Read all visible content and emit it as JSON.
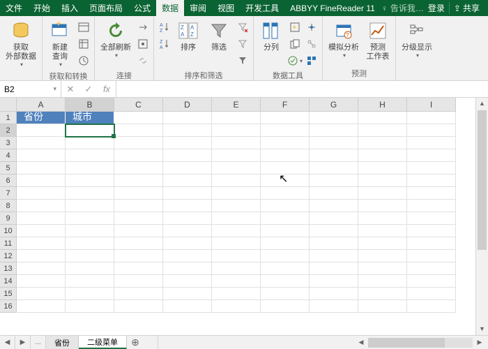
{
  "tabs": {
    "file": "文件",
    "home": "开始",
    "insert": "插入",
    "layout": "页面布局",
    "formulas": "公式",
    "data": "数据",
    "review": "审阅",
    "view": "视图",
    "dev": "开发工具",
    "abbyy": "ABBYY FineReader 11"
  },
  "titleright": {
    "tell": "告诉我…",
    "login": "登录",
    "share": "共享"
  },
  "ribbon": {
    "get": {
      "big": "获取\n外部数据",
      "label": ""
    },
    "query": {
      "big": "新建\n查询",
      "label": "获取和转换"
    },
    "refresh": {
      "big": "全部刷新",
      "label": "连接"
    },
    "sort": {
      "big": "排序",
      "filter": "筛选",
      "label": "排序和筛选"
    },
    "split": {
      "big": "分列",
      "label": "数据工具"
    },
    "whatif": {
      "big": "模拟分析",
      "forecast": "预测\n工作表",
      "label": "预测"
    },
    "outline": {
      "big": "分级显示",
      "label": ""
    }
  },
  "fbar": {
    "name": "B2",
    "fx": "fx"
  },
  "cols": [
    "A",
    "B",
    "C",
    "D",
    "E",
    "F",
    "G",
    "H",
    "I"
  ],
  "rows": [
    "1",
    "2",
    "3",
    "4",
    "5",
    "6",
    "7",
    "8",
    "9",
    "10",
    "11",
    "12",
    "13",
    "14",
    "15",
    "16"
  ],
  "headers": {
    "a1": "省份",
    "b1": "城市"
  },
  "sheets": {
    "s1": "省份",
    "s2": "二级菜单",
    "dots": "..."
  },
  "active": {
    "cell": "B2",
    "col": "B",
    "row": "2"
  }
}
